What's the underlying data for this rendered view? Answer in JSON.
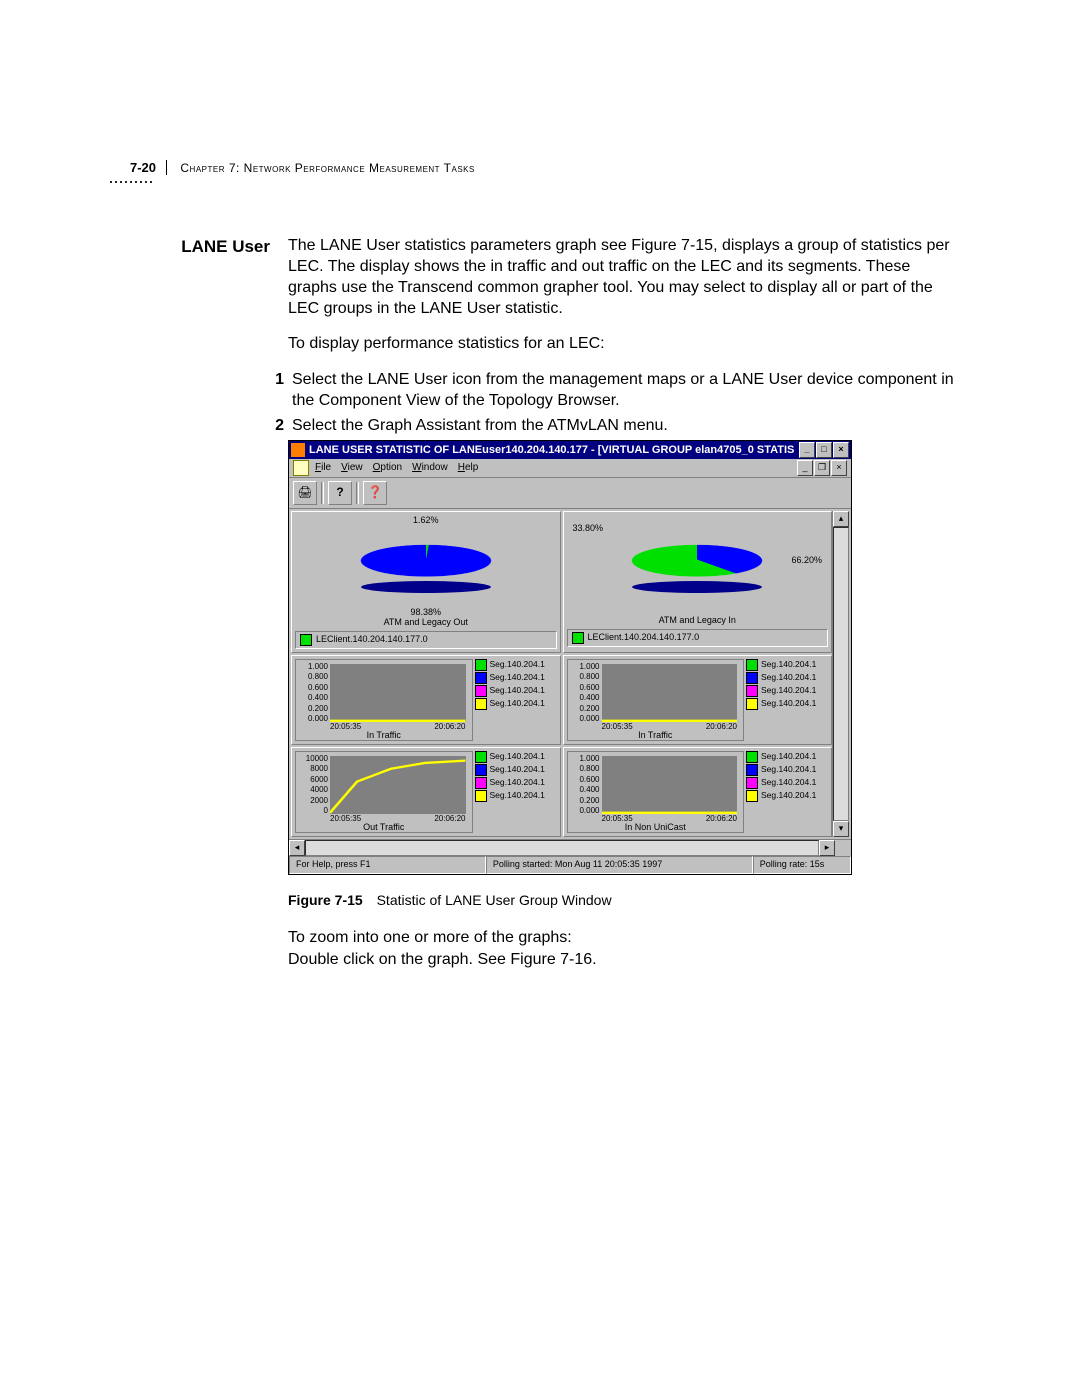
{
  "header": {
    "page_number": "7-20",
    "chapter": "Chapter 7: Network Performance Measurement Tasks"
  },
  "section": {
    "label": "LANE User",
    "body_p1": "The LANE User statistics parameters graph see Figure 7-15, displays a group of statistics per LEC. The display shows the in traffic and out traffic on the LEC and its segments. These graphs use the Transcend common grapher tool. You may select to display all or part of the LEC groups in the LANE User statistic.",
    "body_p2": "To display performance statistics for an LEC:",
    "steps": [
      "Select the LANE User icon from the management maps or a LANE User device component in the Component View of the Topology Browser.",
      "Select the Graph Assistant from the ATMvLAN menu."
    ]
  },
  "figure": {
    "label": "Figure 7-15",
    "caption": "Statistic of LANE User Group Window"
  },
  "post_figure": {
    "line1": "To zoom into one or more of the graphs:",
    "line2": "Double click on the graph. See Figure 7-16."
  },
  "window": {
    "title": "LANE USER STATISTIC OF LANEuser140.204.140.177 - [VIRTUAL GROUP elan4705_0 STATIS...",
    "menu": {
      "file": "File",
      "view": "View",
      "option": "Option",
      "window": "Window",
      "help": "Help"
    },
    "status": {
      "help": "For Help, press F1",
      "polling_started": "Polling started: Mon Aug 11 20:05:35 1997",
      "polling_rate": "Polling rate: 15s"
    },
    "leclient_label": "LEClient.140.204.140.177.0",
    "seg_label": "Seg.140.204.1",
    "pies": {
      "left": {
        "top_pct": "1.62%",
        "bottom_pct": "98.38%",
        "caption": "ATM and Legacy Out"
      },
      "right": {
        "left_pct": "33.80%",
        "right_pct": "66.20%",
        "caption": "ATM and Legacy In"
      }
    },
    "line_charts": {
      "yticks_unit": [
        "1.000",
        "0.800",
        "0.600",
        "0.400",
        "0.200",
        "0.000"
      ],
      "yticks_out": [
        "10000",
        "8000",
        "6000",
        "4000",
        "2000",
        "0"
      ],
      "xticks": [
        "20:05:35",
        "20:06:20"
      ],
      "titles": {
        "in": "In Traffic",
        "out": "Out Traffic",
        "nonuni": "In Non UniCast"
      }
    }
  },
  "chart_data": [
    {
      "type": "pie",
      "title": "ATM and Legacy Out",
      "series": [
        {
          "name": "slice-minor",
          "value": 1.62
        },
        {
          "name": "slice-major",
          "value": 98.38
        }
      ],
      "legend": [
        "LEClient.140.204.140.177.0"
      ]
    },
    {
      "type": "pie",
      "title": "ATM and Legacy In",
      "series": [
        {
          "name": "slice-blue",
          "value": 33.8
        },
        {
          "name": "slice-green",
          "value": 66.2
        }
      ],
      "legend": [
        "LEClient.140.204.140.177.0"
      ]
    },
    {
      "type": "line",
      "title": "In Traffic",
      "x": [
        "20:05:35",
        "20:06:20"
      ],
      "ylim": [
        0,
        1.0
      ],
      "series": [
        {
          "name": "Seg.140.204.1",
          "values": [
            0.0,
            0.0
          ]
        },
        {
          "name": "Seg.140.204.1",
          "values": [
            0.0,
            0.0
          ]
        },
        {
          "name": "Seg.140.204.1",
          "values": [
            0.0,
            0.0
          ]
        },
        {
          "name": "Seg.140.204.1",
          "values": [
            0.0,
            0.0
          ]
        }
      ]
    },
    {
      "type": "line",
      "title": "In Traffic",
      "x": [
        "20:05:35",
        "20:06:20"
      ],
      "ylim": [
        0,
        1.0
      ],
      "series": [
        {
          "name": "Seg.140.204.1",
          "values": [
            0.0,
            0.0
          ]
        },
        {
          "name": "Seg.140.204.1",
          "values": [
            0.0,
            0.0
          ]
        },
        {
          "name": "Seg.140.204.1",
          "values": [
            0.0,
            0.0
          ]
        },
        {
          "name": "Seg.140.204.1",
          "values": [
            0.0,
            0.0
          ]
        }
      ]
    },
    {
      "type": "line",
      "title": "Out Traffic",
      "x": [
        "20:05:35",
        "20:05:45",
        "20:05:55",
        "20:06:05",
        "20:06:20"
      ],
      "ylim": [
        0,
        10000
      ],
      "series": [
        {
          "name": "Seg.140.204.1",
          "values": [
            0,
            5500,
            7800,
            8800,
            9200
          ]
        },
        {
          "name": "Seg.140.204.1",
          "values": [
            0,
            0,
            0,
            0,
            0
          ]
        },
        {
          "name": "Seg.140.204.1",
          "values": [
            0,
            0,
            0,
            0,
            0
          ]
        },
        {
          "name": "Seg.140.204.1",
          "values": [
            0,
            0,
            0,
            0,
            0
          ]
        }
      ]
    },
    {
      "type": "line",
      "title": "In Non UniCast",
      "x": [
        "20:05:35",
        "20:06:20"
      ],
      "ylim": [
        0,
        1.0
      ],
      "series": [
        {
          "name": "Seg.140.204.1",
          "values": [
            0.0,
            0.0
          ]
        },
        {
          "name": "Seg.140.204.1",
          "values": [
            0.0,
            0.0
          ]
        },
        {
          "name": "Seg.140.204.1",
          "values": [
            0.0,
            0.0
          ]
        },
        {
          "name": "Seg.140.204.1",
          "values": [
            0.0,
            0.0
          ]
        }
      ]
    }
  ]
}
